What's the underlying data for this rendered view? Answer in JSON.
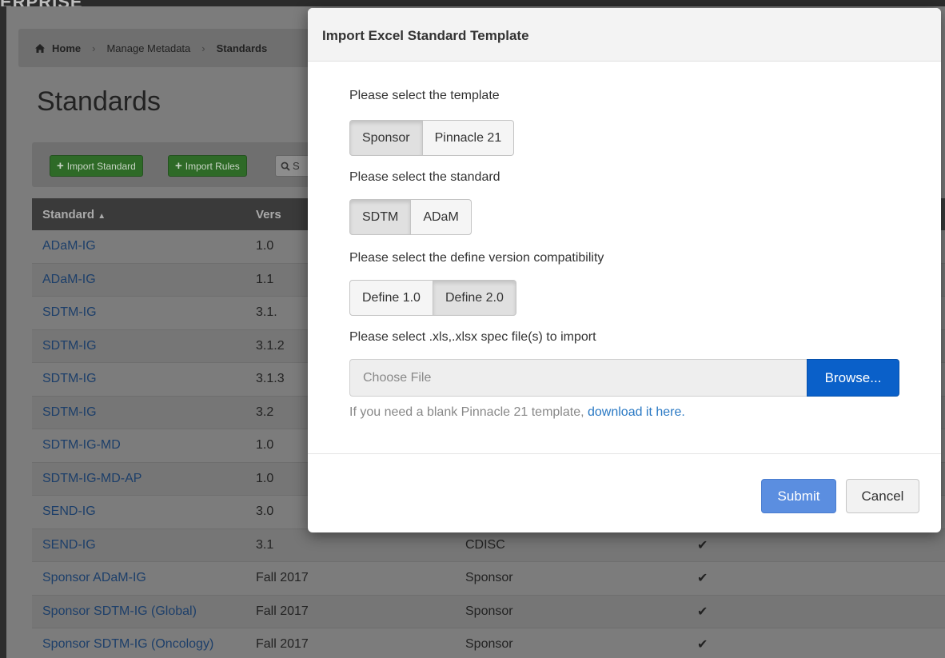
{
  "app": {
    "brand": "ERPRISE"
  },
  "breadcrumb": {
    "home": "Home",
    "manage": "Manage Metadata",
    "current": "Standards"
  },
  "page": {
    "title": "Standards"
  },
  "toolbar": {
    "import_standard": "Import Standard",
    "import_rules": "Import Rules",
    "search_partial": "S"
  },
  "table": {
    "headers": [
      "Standard",
      "Vers",
      "",
      ""
    ],
    "rows": [
      [
        "ADaM-IG",
        "1.0",
        "",
        ""
      ],
      [
        "ADaM-IG",
        "1.1",
        "",
        ""
      ],
      [
        "SDTM-IG",
        "3.1.",
        "",
        ""
      ],
      [
        "SDTM-IG",
        "3.1.2",
        "",
        ""
      ],
      [
        "SDTM-IG",
        "3.1.3",
        "",
        ""
      ],
      [
        "SDTM-IG",
        "3.2",
        "",
        ""
      ],
      [
        "SDTM-IG-MD",
        "1.0",
        "",
        ""
      ],
      [
        "SDTM-IG-MD-AP",
        "1.0",
        "",
        ""
      ],
      [
        "SEND-IG",
        "3.0",
        "",
        ""
      ],
      [
        "SEND-IG",
        "3.1",
        "CDISC",
        "✔"
      ],
      [
        "Sponsor ADaM-IG",
        "Fall 2017",
        "Sponsor",
        "✔"
      ],
      [
        "Sponsor SDTM-IG (Global)",
        "Fall 2017",
        "Sponsor",
        "✔"
      ],
      [
        "Sponsor SDTM-IG (Oncology)",
        "Fall 2017",
        "Sponsor",
        "✔"
      ]
    ]
  },
  "modal": {
    "title": "Import Excel Standard Template",
    "template_label": "Please select the template",
    "template_options": [
      "Sponsor",
      "Pinnacle 21"
    ],
    "template_selected": "Sponsor",
    "standard_label": "Please select the standard",
    "standard_options": [
      "SDTM",
      "ADaM"
    ],
    "standard_selected": "SDTM",
    "define_label": "Please select the define version compatibility",
    "define_options": [
      "Define 1.0",
      "Define 2.0"
    ],
    "define_selected": "Define 2.0",
    "file_label": "Please select .xls,.xlsx spec file(s) to import",
    "file_placeholder": "Choose File",
    "browse": "Browse...",
    "help_text": "If you need a blank Pinnacle 21 template,",
    "help_link": "download it here.",
    "submit": "Submit",
    "cancel": "Cancel"
  },
  "colors": {
    "primary": "#0a60c9",
    "submit": "#5b8ee0",
    "link": "#2a79c4",
    "success": "#2e6a27"
  }
}
